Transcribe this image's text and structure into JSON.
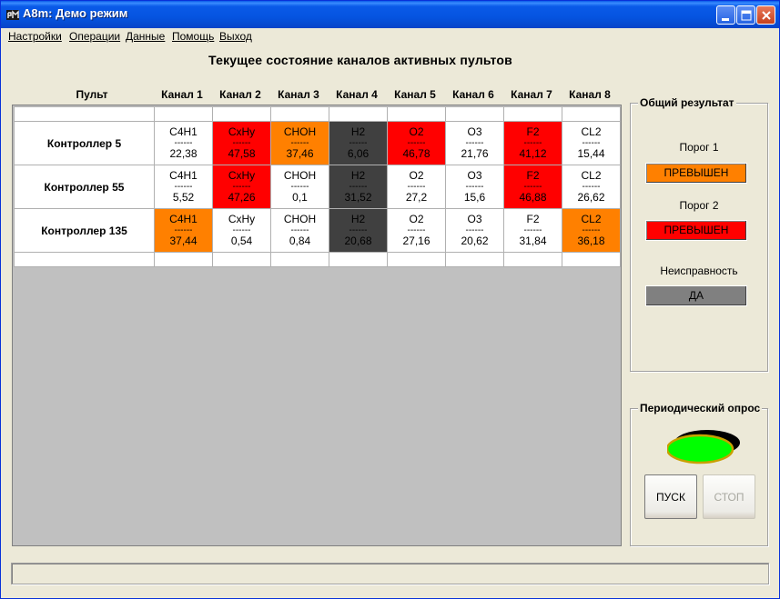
{
  "window": {
    "title": "A8m: Демо режим",
    "accent": "#0a5ae8"
  },
  "menu": [
    "Настройки",
    "Операции",
    "Данные",
    "Помощь",
    "Выход"
  ],
  "main_title": "Текущее состояние каналов активных пультов",
  "table": {
    "row_header": "Пульт",
    "columns": [
      "Канал 1",
      "Канал 2",
      "Канал 3",
      "Канал 4",
      "Канал 5",
      "Канал 6",
      "Канал 7",
      "Канал 8"
    ],
    "separator": "------",
    "rows": [
      {
        "name": "Контроллер 5",
        "cells": [
          {
            "gas": "C4H1",
            "value": "22,38",
            "state": "normal"
          },
          {
            "gas": "CxHy",
            "value": "47,58",
            "state": "red"
          },
          {
            "gas": "CHOH",
            "value": "37,46",
            "state": "orange"
          },
          {
            "gas": "H2",
            "value": "6,06",
            "state": "dark"
          },
          {
            "gas": "O2",
            "value": "46,78",
            "state": "red"
          },
          {
            "gas": "O3",
            "value": "21,76",
            "state": "normal"
          },
          {
            "gas": "F2",
            "value": "41,12",
            "state": "red"
          },
          {
            "gas": "CL2",
            "value": "15,44",
            "state": "normal"
          }
        ]
      },
      {
        "name": "Контроллер 55",
        "cells": [
          {
            "gas": "C4H1",
            "value": "5,52",
            "state": "normal"
          },
          {
            "gas": "CxHy",
            "value": "47,26",
            "state": "red"
          },
          {
            "gas": "CHOH",
            "value": "0,1",
            "state": "normal"
          },
          {
            "gas": "H2",
            "value": "31,52",
            "state": "dark"
          },
          {
            "gas": "O2",
            "value": "27,2",
            "state": "normal"
          },
          {
            "gas": "O3",
            "value": "15,6",
            "state": "normal"
          },
          {
            "gas": "F2",
            "value": "46,88",
            "state": "red"
          },
          {
            "gas": "CL2",
            "value": "26,62",
            "state": "normal"
          }
        ]
      },
      {
        "name": "Контроллер 135",
        "cells": [
          {
            "gas": "C4H1",
            "value": "37,44",
            "state": "orange"
          },
          {
            "gas": "CxHy",
            "value": "0,54",
            "state": "normal"
          },
          {
            "gas": "CHOH",
            "value": "0,84",
            "state": "normal"
          },
          {
            "gas": "H2",
            "value": "20,68",
            "state": "dark"
          },
          {
            "gas": "O2",
            "value": "27,16",
            "state": "normal"
          },
          {
            "gas": "O3",
            "value": "20,62",
            "state": "normal"
          },
          {
            "gas": "F2",
            "value": "31,84",
            "state": "normal"
          },
          {
            "gas": "CL2",
            "value": "36,18",
            "state": "orange"
          }
        ]
      }
    ]
  },
  "result": {
    "title": "Общий результат",
    "threshold1_label": "Порог 1",
    "threshold1_value": "ПРЕВЫШЕН",
    "threshold1_color": "#ff8000",
    "threshold2_label": "Порог 2",
    "threshold2_value": "ПРЕВЫШЕН",
    "threshold2_color": "#ff0000",
    "fault_label": "Неисправность",
    "fault_value": "ДА",
    "fault_color": "#808080"
  },
  "polling": {
    "title": "Периодический опрос",
    "lamp_color": "#00ff00",
    "start_label": "ПУСК",
    "stop_label": "СТОП"
  },
  "colors": {
    "red": "#ff0000",
    "orange": "#ff8000",
    "dark": "#404040"
  }
}
